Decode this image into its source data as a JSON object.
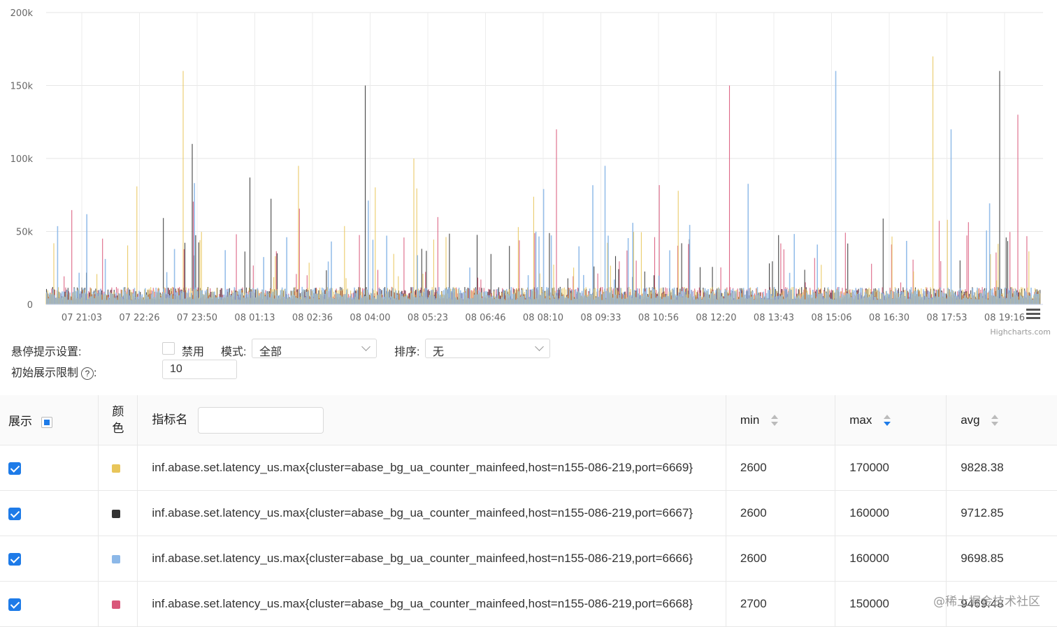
{
  "chart_data": {
    "type": "line",
    "y_ticks": [
      "200k",
      "150k",
      "100k",
      "50k",
      "0"
    ],
    "ylim": [
      0,
      200000
    ],
    "x_ticks": [
      "07 21:03",
      "07 22:26",
      "07 23:50",
      "08 01:13",
      "08 02:36",
      "08 04:00",
      "08 05:23",
      "08 06:46",
      "08 08:10",
      "08 09:33",
      "08 10:56",
      "08 12:20",
      "08 13:43",
      "08 15:06",
      "08 16:30",
      "08 17:53",
      "08 19:16"
    ],
    "grid": true,
    "credit": "Highcharts.com",
    "series": [
      {
        "color": "#e8c55a",
        "peaks": [
          {
            "x": "07 23:50",
            "y": 160000
          },
          {
            "x": "08 17:53",
            "y": 170000
          },
          {
            "x": "08 05:23",
            "y": 100000
          },
          {
            "x": "08 02:36",
            "y": 95000
          }
        ]
      },
      {
        "color": "#333333",
        "peaks": [
          {
            "x": "08 04:00",
            "y": 150000
          },
          {
            "x": "08 19:16",
            "y": 160000
          },
          {
            "x": "07 23:50",
            "y": 110000
          },
          {
            "x": "08 01:13",
            "y": 87000
          }
        ]
      },
      {
        "color": "#8cb8e8",
        "peaks": [
          {
            "x": "08 15:06",
            "y": 160000
          },
          {
            "x": "08 17:53",
            "y": 120000
          },
          {
            "x": "08 09:33",
            "y": 95000
          }
        ]
      },
      {
        "color": "#d9577a",
        "peaks": [
          {
            "x": "08 12:20",
            "y": 150000
          },
          {
            "x": "08 19:16",
            "y": 130000
          },
          {
            "x": "08 08:10",
            "y": 120000
          }
        ]
      }
    ]
  },
  "settings": {
    "hover_label": "悬停提示设置:",
    "disable_label": "禁用",
    "mode_label": "模式:",
    "mode_value": "全部",
    "sort_label": "排序:",
    "sort_value": "无",
    "limit_label": "初始展示限制",
    "limit_help": "?",
    "limit_colon": ":",
    "limit_value": "10"
  },
  "table": {
    "headers": {
      "show": "展示",
      "color": "颜\n色",
      "name": "指标名",
      "min": "min",
      "max": "max",
      "avg": "avg"
    },
    "rows": [
      {
        "color": "#e8c55a",
        "name": "inf.abase.set.latency_us.max{cluster=abase_bg_ua_counter_mainfeed,host=n155-086-219,port=6669}",
        "min": "2600",
        "max": "170000",
        "avg": "9828.38"
      },
      {
        "color": "#333333",
        "name": "inf.abase.set.latency_us.max{cluster=abase_bg_ua_counter_mainfeed,host=n155-086-219,port=6667}",
        "min": "2600",
        "max": "160000",
        "avg": "9712.85"
      },
      {
        "color": "#8cb8e8",
        "name": "inf.abase.set.latency_us.max{cluster=abase_bg_ua_counter_mainfeed,host=n155-086-219,port=6666}",
        "min": "2600",
        "max": "160000",
        "avg": "9698.85"
      },
      {
        "color": "#d9577a",
        "name": "inf.abase.set.latency_us.max{cluster=abase_bg_ua_counter_mainfeed,host=n155-086-219,port=6668}",
        "min": "2700",
        "max": "150000",
        "avg": "9469.48"
      }
    ]
  },
  "watermark": "@稀土掘金技术社区"
}
